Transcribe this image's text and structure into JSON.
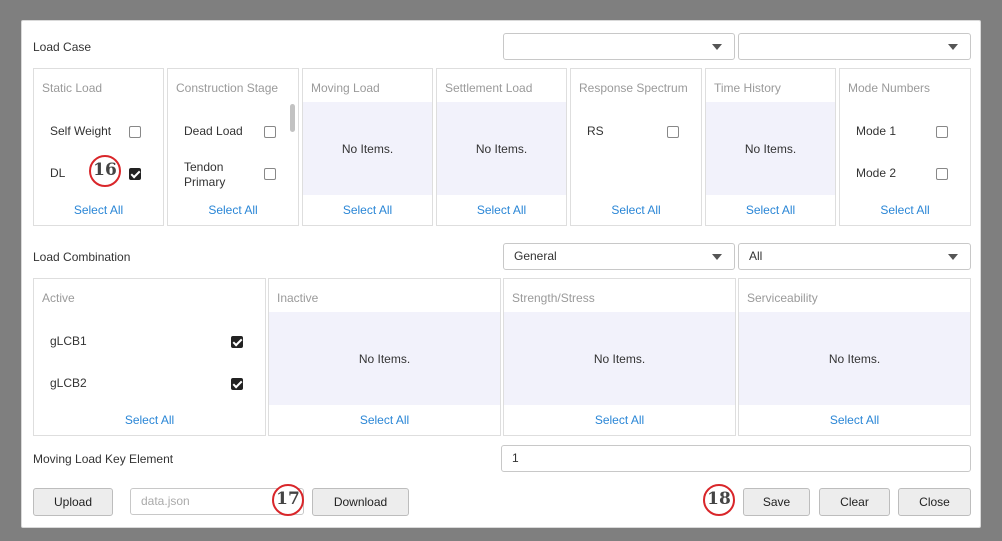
{
  "load_case": {
    "title": "Load Case",
    "dropdown1": "",
    "dropdown2": "",
    "panels": {
      "static": {
        "title": "Static Load",
        "items": [
          {
            "label": "Self Weight",
            "checked": false
          },
          {
            "label": "DL",
            "checked": true
          }
        ],
        "select_all": "Select All"
      },
      "construction": {
        "title": "Construction Stage",
        "items": [
          {
            "label": "Dead Load",
            "checked": false
          },
          {
            "label": "Tendon Primary",
            "checked": false
          }
        ],
        "select_all": "Select All"
      },
      "moving": {
        "title": "Moving Load",
        "empty": "No Items.",
        "select_all": "Select All"
      },
      "settlement": {
        "title": "Settlement Load",
        "empty": "No Items.",
        "select_all": "Select All"
      },
      "response": {
        "title": "Response Spectrum",
        "items": [
          {
            "label": "RS",
            "checked": false
          }
        ],
        "select_all": "Select All"
      },
      "time_history": {
        "title": "Time History",
        "empty": "No Items.",
        "select_all": "Select All"
      },
      "mode": {
        "title": "Mode Numbers",
        "items": [
          {
            "label": "Mode 1",
            "checked": false
          },
          {
            "label": "Mode 2",
            "checked": false
          }
        ],
        "select_all": "Select All"
      }
    }
  },
  "load_combination": {
    "title": "Load Combination",
    "dropdown1": "General",
    "dropdown2": "All",
    "panels": {
      "active": {
        "title": "Active",
        "items": [
          {
            "label": "gLCB1",
            "checked": true
          },
          {
            "label": "gLCB2",
            "checked": true
          }
        ],
        "select_all": "Select All"
      },
      "inactive": {
        "title": "Inactive",
        "empty": "No Items.",
        "select_all": "Select All"
      },
      "strength": {
        "title": "Strength/Stress",
        "empty": "No Items.",
        "select_all": "Select All"
      },
      "serviceability": {
        "title": "Serviceability",
        "empty": "No Items.",
        "select_all": "Select All"
      }
    }
  },
  "moving_key": {
    "label": "Moving Load Key Element",
    "value": "1"
  },
  "footer": {
    "upload": "Upload",
    "file_placeholder": "data.json",
    "download": "Download",
    "save": "Save",
    "clear": "Clear",
    "close": "Close"
  },
  "markers": {
    "m16": "16",
    "m17": "17",
    "m18": "18"
  }
}
